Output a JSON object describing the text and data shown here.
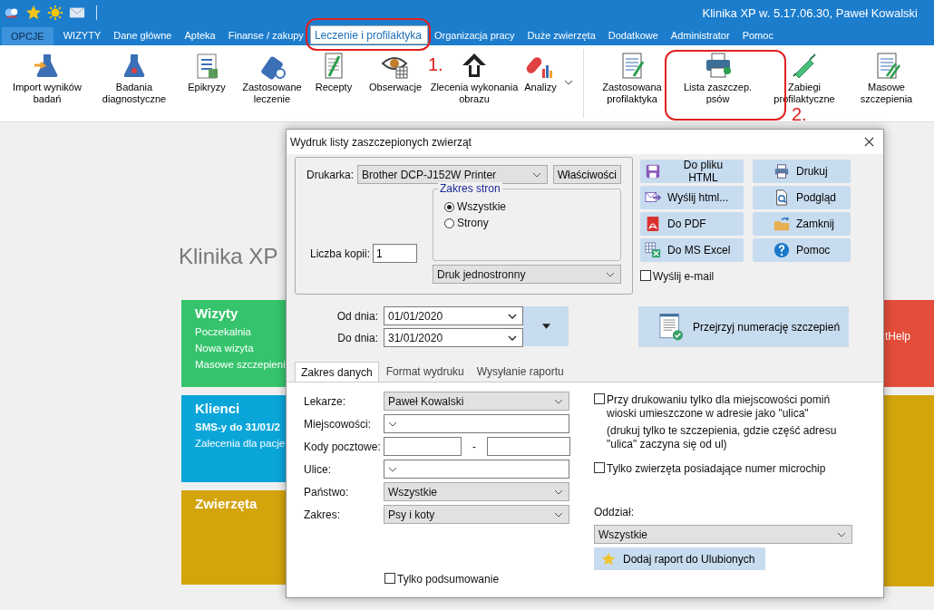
{
  "app": {
    "title": "Klinika XP w. 5.17.06.30, Paweł Kowalski"
  },
  "menu": [
    {
      "label": "OPCJE",
      "kind": "options",
      "selected": false
    },
    {
      "label": "WIZYTY",
      "kind": "tab",
      "selected": false
    },
    {
      "label": "Dane główne",
      "kind": "tab",
      "selected": false
    },
    {
      "label": "Apteka",
      "kind": "tab",
      "selected": false
    },
    {
      "label": "Finanse / zakupy",
      "kind": "tab",
      "selected": false
    },
    {
      "label": "Leczenie i profilaktyka",
      "kind": "tab",
      "selected": true
    },
    {
      "label": "Organizacja pracy",
      "kind": "tab",
      "selected": false
    },
    {
      "label": "Duże zwierzęta",
      "kind": "tab",
      "selected": false
    },
    {
      "label": "Dodatkowe",
      "kind": "tab",
      "selected": false
    },
    {
      "label": "Administrator",
      "kind": "tab",
      "selected": false
    },
    {
      "label": "Pomoc",
      "kind": "tab",
      "selected": false
    }
  ],
  "ribbon": {
    "groups": [
      {
        "items": [
          {
            "label": "Import wyników\nbadań",
            "dropdown": false
          },
          {
            "label": "Badania\ndiagnostyczne",
            "dropdown": false
          },
          {
            "label": "Epikryzy",
            "dropdown": false
          },
          {
            "label": "Zastosowane\nleczenie",
            "dropdown": false
          },
          {
            "label": "Recepty",
            "dropdown": false
          },
          {
            "label": "Obserwacje",
            "dropdown": false
          },
          {
            "label": "Zlecenia wykonania\nobrazu",
            "dropdown": false
          },
          {
            "label": "Analizy",
            "dropdown": true
          }
        ]
      },
      {
        "items": [
          {
            "label": "Zastosowana\nprofilaktyka",
            "dropdown": false
          },
          {
            "label": "Lista zaszczep.\npsów",
            "dropdown": false
          },
          {
            "label": "Zabiegi\nprofilaktyczne",
            "dropdown": false
          },
          {
            "label": "Masowe\nszczepienia",
            "dropdown": false
          }
        ]
      }
    ]
  },
  "annotations": [
    {
      "label": "1."
    },
    {
      "label": "2."
    }
  ],
  "home": {
    "heading": "Klinika XP",
    "tiles": [
      {
        "title": "Wizyty",
        "color": "#35c46c",
        "items": [
          {
            "text": "Poczekalnia",
            "bold": false
          },
          {
            "text": "Nowa wizyta",
            "bold": false
          },
          {
            "text": "Masowe szczepieni",
            "bold": false
          }
        ]
      },
      {
        "title": "Klienci",
        "color": "#0aa6da",
        "items": [
          {
            "text": "SMS-y do 31/01/2",
            "bold": true
          },
          {
            "text": "Zalecenia dla pacje",
            "bold": false
          }
        ]
      },
      {
        "title": "Zwierzęta",
        "color": "#d3a40c"
      }
    ],
    "right_tiles": [
      {
        "color": "#e44d3a",
        "text": "tHelp"
      },
      {
        "color": "#d3a40c"
      }
    ]
  },
  "dialog": {
    "title": "Wydruk listy zaszczepionych zwierząt",
    "printer": {
      "label": "Drukarka:",
      "value": "Brother DCP-J152W Printer",
      "button": "Właściwości"
    },
    "page_range": {
      "legend": "Zakres stron",
      "options": [
        {
          "label": "Wszystkie",
          "selected": true
        },
        {
          "label": "Strony",
          "selected": false
        }
      ]
    },
    "copies": {
      "label": "Liczba kopii:",
      "value": "1"
    },
    "duplex": {
      "value": "Druk jednostronny"
    },
    "buttons": [
      {
        "label": "Do pliku HTML"
      },
      {
        "label": "Drukuj"
      },
      {
        "label": "Wyślij html..."
      },
      {
        "label": "Podgląd"
      },
      {
        "label": "Do PDF"
      },
      {
        "label": "Zamknij"
      },
      {
        "label": "Do MS Excel"
      },
      {
        "label": "Pomoc"
      }
    ],
    "send_email": {
      "label": "Wyślij e-mail",
      "checked": false
    },
    "dates": [
      {
        "label": "Od dnia:",
        "value": "01/01/2020"
      },
      {
        "label": "Do dnia:",
        "value": "31/01/2020"
      }
    ],
    "review_button": {
      "label": "Przejrzyj numerację szczepień"
    },
    "tabs": [
      {
        "label": "Zakres danych",
        "selected": true
      },
      {
        "label": "Format wydruku",
        "selected": false
      },
      {
        "label": "Wysyłanie raportu",
        "selected": false
      }
    ],
    "fields": [
      {
        "label": "Lekarze:",
        "kind": "select",
        "value": "Paweł Kowalski"
      },
      {
        "label": "Miejscowości:",
        "kind": "combo"
      },
      {
        "label": "Kody pocztowe:",
        "kind": "postcode",
        "separator": "-"
      },
      {
        "label": "Ulice:",
        "kind": "combo"
      },
      {
        "label": "Państwo:",
        "kind": "select",
        "value": "Wszystkie"
      },
      {
        "label": "Zakres:",
        "kind": "select",
        "value": "Psy i koty"
      }
    ],
    "summary_only": {
      "label": "Tylko podsumowanie",
      "checked": false
    },
    "options": [
      {
        "label": "Przy drukowaniu tylko dla miejscowości pomiń wioski umieszczone w adresie jako \"ulica\"",
        "checked": false,
        "note": "(drukuj tylko te szczepienia, gdzie część adresu \"ulica\" zaczyna się od ul)"
      },
      {
        "label": "Tylko zwierzęta posiadające numer microchip",
        "checked": false
      }
    ],
    "branch": {
      "label": "Oddział:",
      "value": "Wszystkie"
    },
    "favorite_button": {
      "label": "Dodaj raport do Ulubionych"
    }
  }
}
